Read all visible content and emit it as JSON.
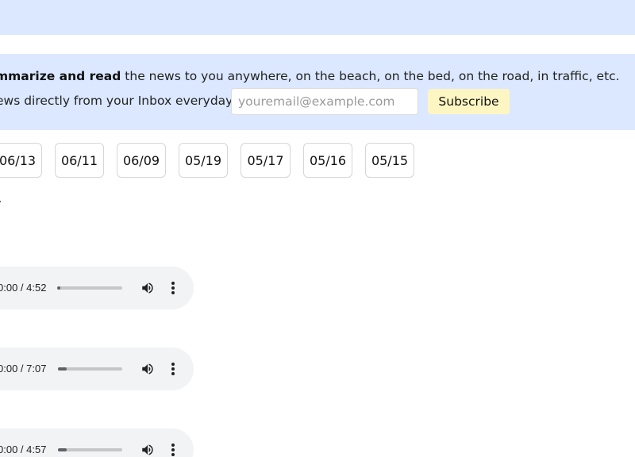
{
  "promo": {
    "line1_bold": "mmarize and read",
    "line1_rest": " the news to you anywhere, on the beach, on the bed, on the road, in traffic, etc.",
    "line2": "ews directly from your Inbox everyday:",
    "email_placeholder": "youremail@example.com",
    "email_value": "",
    "subscribe_label": "Subscribe"
  },
  "dates": [
    "06/13",
    "06/11",
    "06/09",
    "05/19",
    "05/17",
    "05/16",
    "05/15"
  ],
  "stray_text": ".",
  "players": [
    {
      "time": "0:00 / 4:52",
      "progress": 0.0
    },
    {
      "time": "0:00 / 7:07",
      "progress": 0.14
    },
    {
      "time": "0:00 / 4:57",
      "progress": 0.14
    }
  ],
  "colors": {
    "banner_bg": "#dbe8ff",
    "subscribe_bg": "#fdf6c3",
    "player_bg": "#f1f3f4"
  },
  "icons": {
    "volume": "volume-icon",
    "menu": "more-vert-icon"
  }
}
